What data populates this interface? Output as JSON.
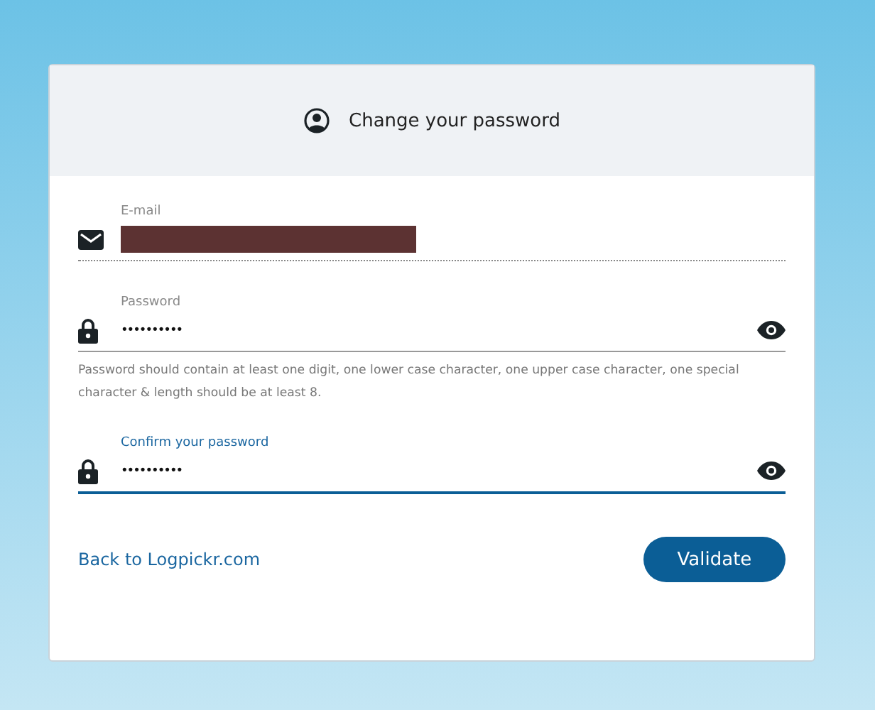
{
  "header": {
    "title": "Change your password"
  },
  "fields": [
    {
      "kind": "email",
      "label": "E-mail",
      "redacted": true,
      "disabled": true,
      "focused": false
    },
    {
      "kind": "password",
      "label": "Password",
      "value": "••••••••••",
      "disabled": false,
      "focused": false,
      "help": "Password should contain at least one digit, one lower case character, one upper case character, one special character & length should be at least 8."
    },
    {
      "kind": "password",
      "label": "Confirm your password",
      "value": "••••••••••",
      "disabled": false,
      "focused": true
    }
  ],
  "footer": {
    "link": "Back to Logpickr.com",
    "button": "Validate"
  }
}
